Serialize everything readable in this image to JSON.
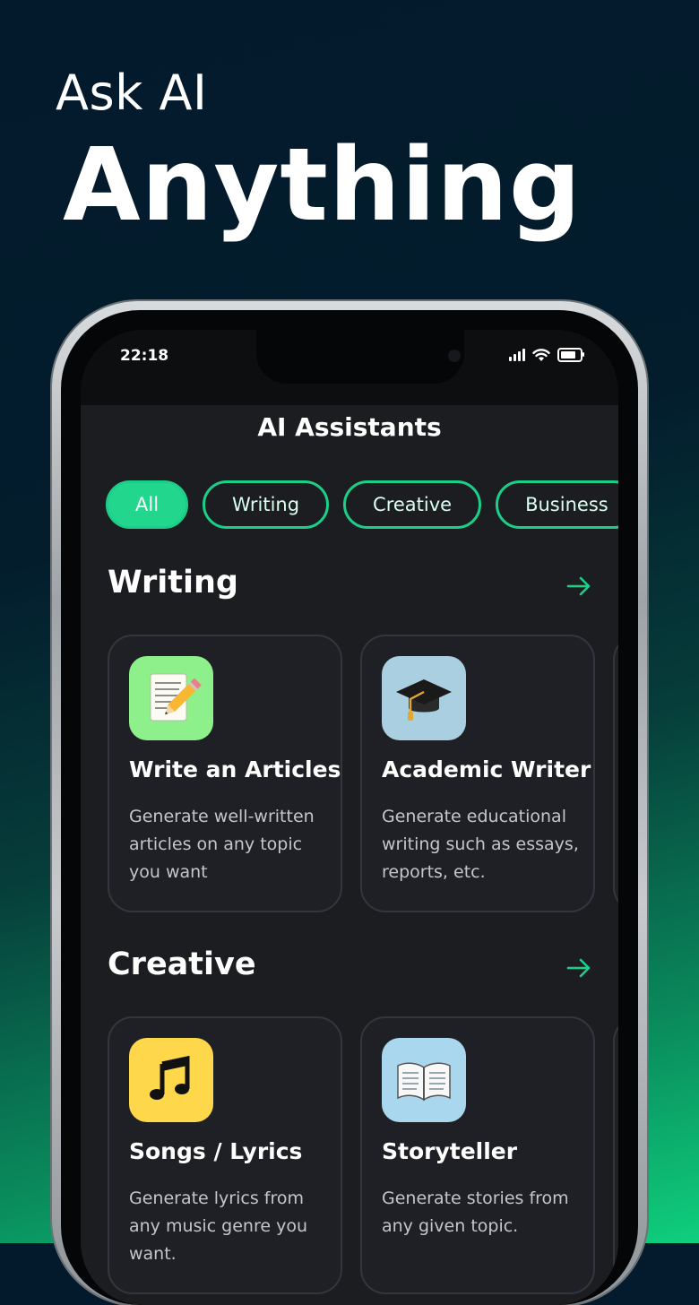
{
  "promo": {
    "line1": "Ask AI",
    "line2": "Anything"
  },
  "status": {
    "time": "22:18"
  },
  "page": {
    "title": "AI Assistants"
  },
  "chips": [
    "All",
    "Writing",
    "Creative",
    "Business",
    ""
  ],
  "colors": {
    "accent": "#22d68d",
    "chip_border": "#1ccf89",
    "screen_bg": "#1c1d21"
  },
  "sections": [
    {
      "title": "Writing",
      "cards": [
        {
          "name": "Write an Articles",
          "desc": "Generate well-written articles on any topic you want",
          "icon": "pencil-paper-icon",
          "icon_bg": "#8ef08a"
        },
        {
          "name": "Academic Writer",
          "desc": "Generate educational writing such as essays, reports, etc.",
          "icon": "graduation-cap-icon",
          "icon_bg": "#a9cfe0"
        }
      ]
    },
    {
      "title": "Creative",
      "cards": [
        {
          "name": "Songs / Lyrics",
          "desc": "Generate lyrics from any music genre you want.",
          "icon": "music-note-icon",
          "icon_bg": "#ffd74a"
        },
        {
          "name": "Storyteller",
          "desc": "Generate stories from any given topic.",
          "icon": "open-book-icon",
          "icon_bg": "#a9d8ee"
        }
      ]
    }
  ]
}
